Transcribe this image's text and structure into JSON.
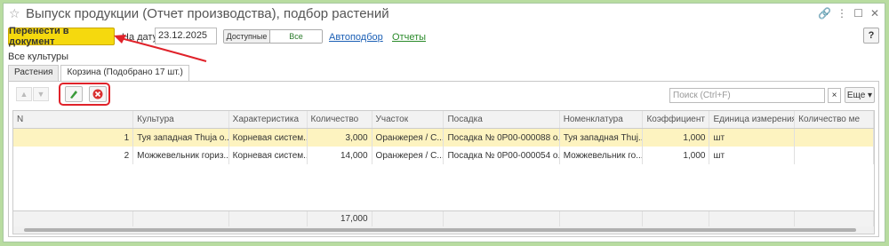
{
  "window": {
    "title": "Выпуск продукции (Отчет производства), подбор растений"
  },
  "toolbar": {
    "transfer_label": "Перенести в документ",
    "date_label": "На дату:",
    "date_value": "23.12.2025",
    "seg_available": "Доступные",
    "seg_all": "Все",
    "autoselect_label": "Автоподбор",
    "reports_label": "Отчеты",
    "help_label": "?"
  },
  "filter": {
    "crop_label": "Все культуры"
  },
  "tabs": [
    {
      "label": "Растения"
    },
    {
      "label": "Корзина (Подобрано 17 шт.)"
    }
  ],
  "panel": {
    "search_placeholder": "Поиск (Ctrl+F)",
    "search_clear": "×",
    "more_label": "Еще"
  },
  "table": {
    "headers": [
      "N",
      "Культура",
      "Характеристика",
      "Количество",
      "Участок",
      "Посадка",
      "Номенклатура",
      "Коэффициент",
      "Единица измерения...",
      "Количество ме"
    ],
    "rows": [
      [
        "1",
        "Туя западная Thuja o...",
        "Корневая систем...",
        "3,000",
        "Оранжерея / С...",
        "Посадка № 0Р00-000088 о...",
        "Туя западная Thuj...",
        "1,000",
        "шт",
        ""
      ],
      [
        "2",
        "Можжевельник гориз...",
        "Корневая систем...",
        "14,000",
        "Оранжерея / С...",
        "Посадка № 0Р00-000054 о...",
        "Можжевельник го...",
        "1,000",
        "шт",
        ""
      ]
    ],
    "total_quantity": "17,000"
  },
  "colors": {
    "accent_yellow": "#f5d90e",
    "highlight_red": "#e0222a",
    "selected_row": "#fdf3c0"
  }
}
